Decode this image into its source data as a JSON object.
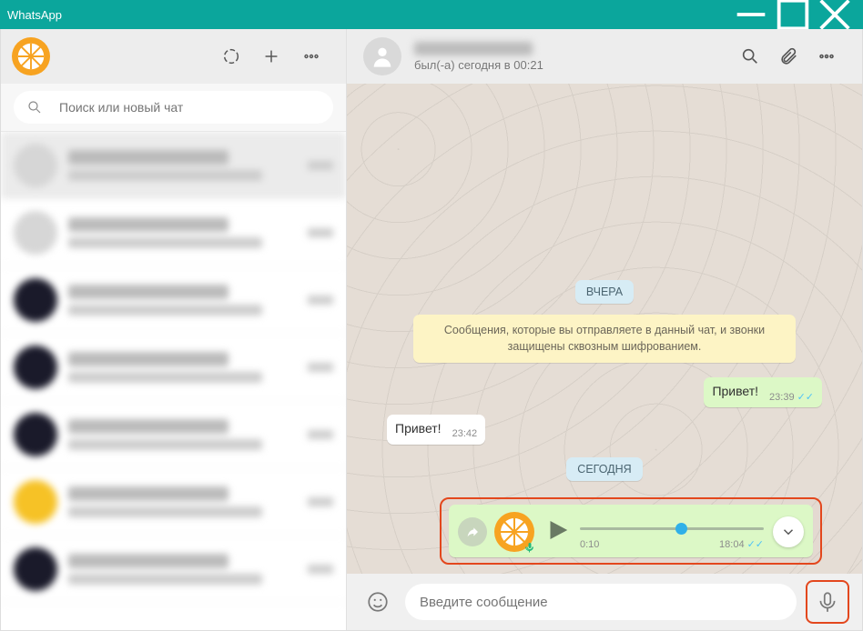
{
  "titlebar": {
    "title": "WhatsApp"
  },
  "left": {
    "search_placeholder": "Поиск или новый чат"
  },
  "chat": {
    "status": "был(-а) сегодня в 00:21",
    "date1": "ВЧЕРА",
    "encryption": "Сообщения, которые вы отправляете в данный чат, и звонки защищены сквозным шифрованием.",
    "msg_out1": "Привет!",
    "msg_out1_time": "23:39",
    "msg_in1": "Привет!",
    "msg_in1_time": "23:42",
    "date2": "СЕГОДНЯ",
    "voice_duration": "0:10",
    "voice_time": "18:04"
  },
  "composer": {
    "placeholder": "Введите сообщение"
  },
  "tick": "✓✓"
}
